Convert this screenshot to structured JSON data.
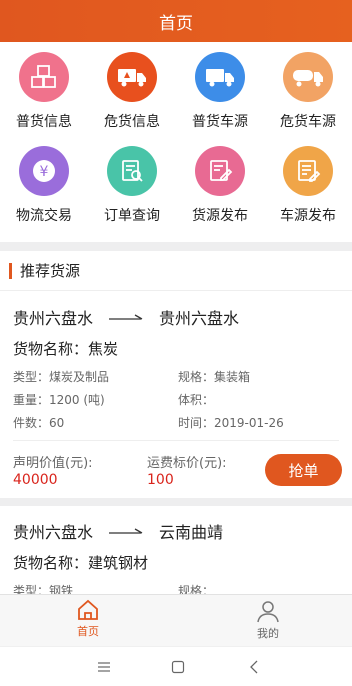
{
  "header": {
    "title": "首页"
  },
  "menu": [
    {
      "label": "普货信息",
      "icon": "cargo-boxes-icon",
      "color": "#f0728c"
    },
    {
      "label": "危货信息",
      "icon": "hazard-truck-icon",
      "color": "#e8501e"
    },
    {
      "label": "普货车源",
      "icon": "truck-icon",
      "color": "#3d8de8"
    },
    {
      "label": "危货车源",
      "icon": "tanker-truck-icon",
      "color": "#f2a364"
    },
    {
      "label": "物流交易",
      "icon": "yen-icon",
      "color": "#9a6ddb"
    },
    {
      "label": "订单查询",
      "icon": "order-search-icon",
      "color": "#49c4a8"
    },
    {
      "label": "货源发布",
      "icon": "publish-cargo-icon",
      "color": "#e86a93"
    },
    {
      "label": "车源发布",
      "icon": "publish-vehicle-icon",
      "color": "#f0a548"
    }
  ],
  "section": {
    "title": "推荐货源"
  },
  "cards": [
    {
      "from": "贵州六盘水",
      "to": "贵州六盘水",
      "goods": "货物名称：焦炭",
      "type": "类型：煤炭及制品",
      "spec": "规格：集装箱",
      "weight": "重量：1200 (吨)",
      "volume": "体积：",
      "count": "件数：60",
      "time": "时间：2019-01-26",
      "declared_label": "声明价值(元):",
      "declared_value": "40000",
      "freight_label": "运费标价(元):",
      "freight_value": "100",
      "button": "抢单"
    },
    {
      "from": "贵州六盘水",
      "to": "云南曲靖",
      "goods": "货物名称：建筑钢材",
      "type": "类型：钢铁",
      "spec": "规格："
    }
  ],
  "tabs": [
    {
      "label": "首页",
      "icon": "home-icon",
      "active": true
    },
    {
      "label": "我的",
      "icon": "user-icon",
      "active": false
    }
  ],
  "system_nav": {
    "menu_icon": "menu-lines-icon",
    "home_icon": "square-home-icon",
    "back_icon": "back-chevron-icon"
  },
  "colors": {
    "accent": "#e0571f",
    "price": "#d9241c"
  }
}
